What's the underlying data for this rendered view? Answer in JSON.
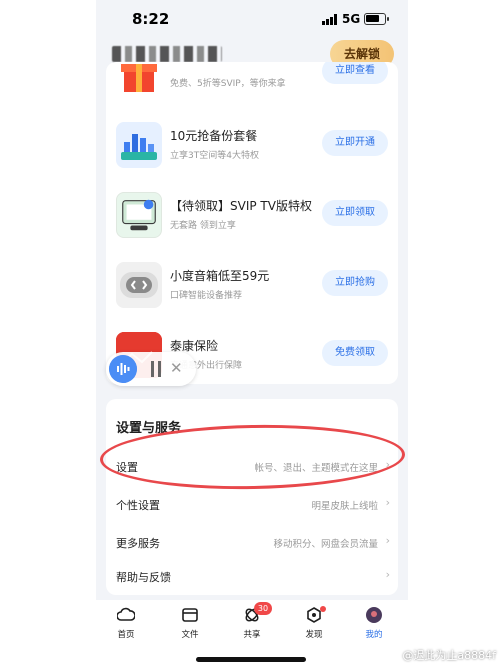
{
  "status_bar": {
    "time": "8:22",
    "network": "5G"
  },
  "header": {
    "unlock_button": "去解锁"
  },
  "promos": [
    {
      "title": "",
      "subtitle": "免费、5折等SVIP，等你来拿",
      "button": "立即查看",
      "icon": "gift-box-icon"
    },
    {
      "title": "10元抢备份套餐",
      "subtitle": "立享3T空间等4大特权",
      "button": "立即开通",
      "icon": "backup-package-icon"
    },
    {
      "title": "【待领取】SVIP TV版特权",
      "subtitle": "无套路 领到立享",
      "button": "立即领取",
      "icon": "tv-privilege-icon"
    },
    {
      "title": "小度音箱低至59元",
      "subtitle": "口碑智能设备推荐",
      "button": "立即抢购",
      "icon": "speaker-icon"
    },
    {
      "title": "泰康保险",
      "subtitle": "交通意外出行保障",
      "button": "免费领取",
      "icon": "insurance-icon"
    }
  ],
  "settings": {
    "heading": "设置与服务",
    "rows": [
      {
        "label": "设置",
        "detail": "帐号、退出、主题模式在这里"
      },
      {
        "label": "个性设置",
        "detail": "明星皮肤上线啦"
      },
      {
        "label": "更多服务",
        "detail": "移动积分、网盘会员流量"
      },
      {
        "label": "帮助与反馈",
        "detail": ""
      }
    ]
  },
  "tabs": [
    {
      "label": "首页",
      "icon": "cloud-home-icon"
    },
    {
      "label": "文件",
      "icon": "folder-icon"
    },
    {
      "label": "共享",
      "icon": "share-icon",
      "badge": "30"
    },
    {
      "label": "发现",
      "icon": "discover-icon"
    },
    {
      "label": "我的",
      "icon": "avatar-icon"
    }
  ],
  "watermark": "@迟此为止a8884f",
  "colors": {
    "accent": "#2a6fe6",
    "annotation": "#e8484b",
    "badge": "#f04848"
  }
}
